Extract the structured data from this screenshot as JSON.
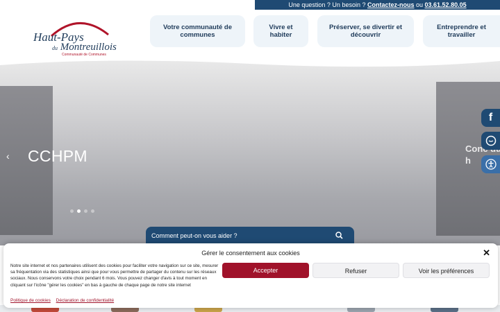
{
  "topbar": {
    "question": "Une question ? Un besoin ?",
    "contact_label": "Contactez-nous",
    "or": "ou",
    "phone": "03.61.52.80.05"
  },
  "logo": {
    "line1": "Haut-Pays",
    "line2_small": "du",
    "line2": "Montreuillois",
    "line3": "Communauté de Communes"
  },
  "nav": {
    "items": [
      {
        "label": "Votre communauté de communes"
      },
      {
        "label": "Vivre et habiter"
      },
      {
        "label": "Préserver, se divertir et découvrir"
      },
      {
        "label": "Entreprendre et travailler"
      }
    ]
  },
  "hero": {
    "title": "CCHPM",
    "side_title": "Conc du h",
    "prev_arrow": "‹",
    "active_dot": 2,
    "dot_count": 4
  },
  "social": {
    "icons": [
      "facebook-icon",
      "chat-icon",
      "accessibility-icon"
    ],
    "colors": {
      "primary": "#1f4a73",
      "accessibility": "#3a6fa8"
    }
  },
  "search": {
    "placeholder": "Comment peut-on vous aider ?"
  },
  "cookie": {
    "title": "Gérer le consentement aux cookies",
    "text": "Notre site internet et nos partenaires utilisent des cookies pour faciliter votre navigation sur ce site, mesurer sa fréquentation via des statistiques ainsi que pour vous permettre de partager du contenu sur les réseaux sociaux. Nous conservons votre choix pendant 6 mois. Vous pouvez changer d'avis à tout moment en cliquant sur l'icône \"gérer les cookies\" en bas à gauche de chaque page de notre site internet",
    "accept": "Accepter",
    "refuse": "Refuser",
    "prefs": "Voir les préférences",
    "policy": "Politique de cookies",
    "privacy": "Déclaration de confidentialité",
    "close": "✕",
    "accent": "#a0122a"
  }
}
